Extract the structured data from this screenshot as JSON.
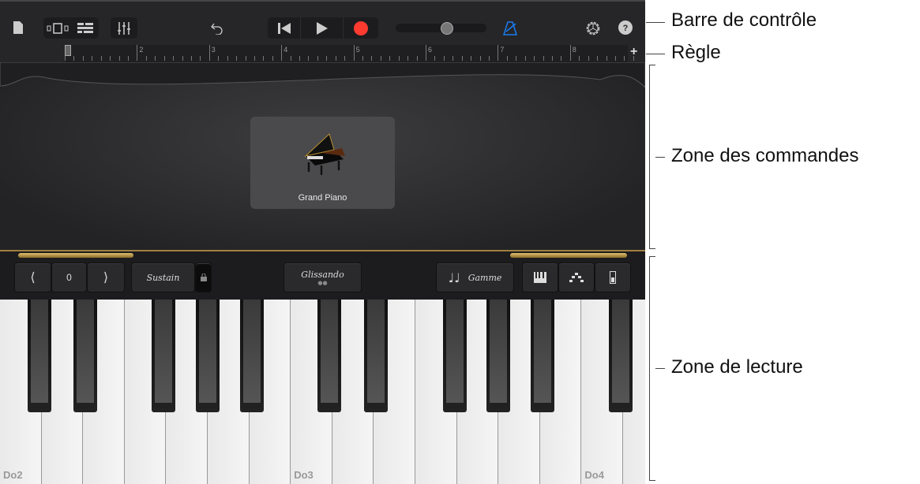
{
  "control_bar": {
    "icons": [
      "document-icon",
      "view-toggle-icon",
      "tracks-icon",
      "mixer-icon",
      "undo-icon",
      "rewind-icon",
      "play-icon",
      "record-icon",
      "volume-slider",
      "metronome-icon",
      "settings-icon",
      "help-icon"
    ],
    "volume_level": 0.5,
    "accent": "#1a7cf0",
    "record_color": "#ff3b30"
  },
  "ruler": {
    "bars": [
      "1",
      "2",
      "3",
      "4",
      "5",
      "6",
      "7",
      "8"
    ],
    "add_label": "+"
  },
  "instrument": {
    "name": "Grand Piano"
  },
  "keyboard_controls": {
    "octave_value": "0",
    "sustain": "Sustain",
    "glissando": "Glissando",
    "scale": "Gamme"
  },
  "keyboard": {
    "labels": {
      "0": "Do2",
      "7": "Do3",
      "14": "Do4"
    }
  },
  "callouts": {
    "control_bar": "Barre de contrôle",
    "ruler": "Règle",
    "controls": "Zone des commandes",
    "play": "Zone de lecture"
  }
}
